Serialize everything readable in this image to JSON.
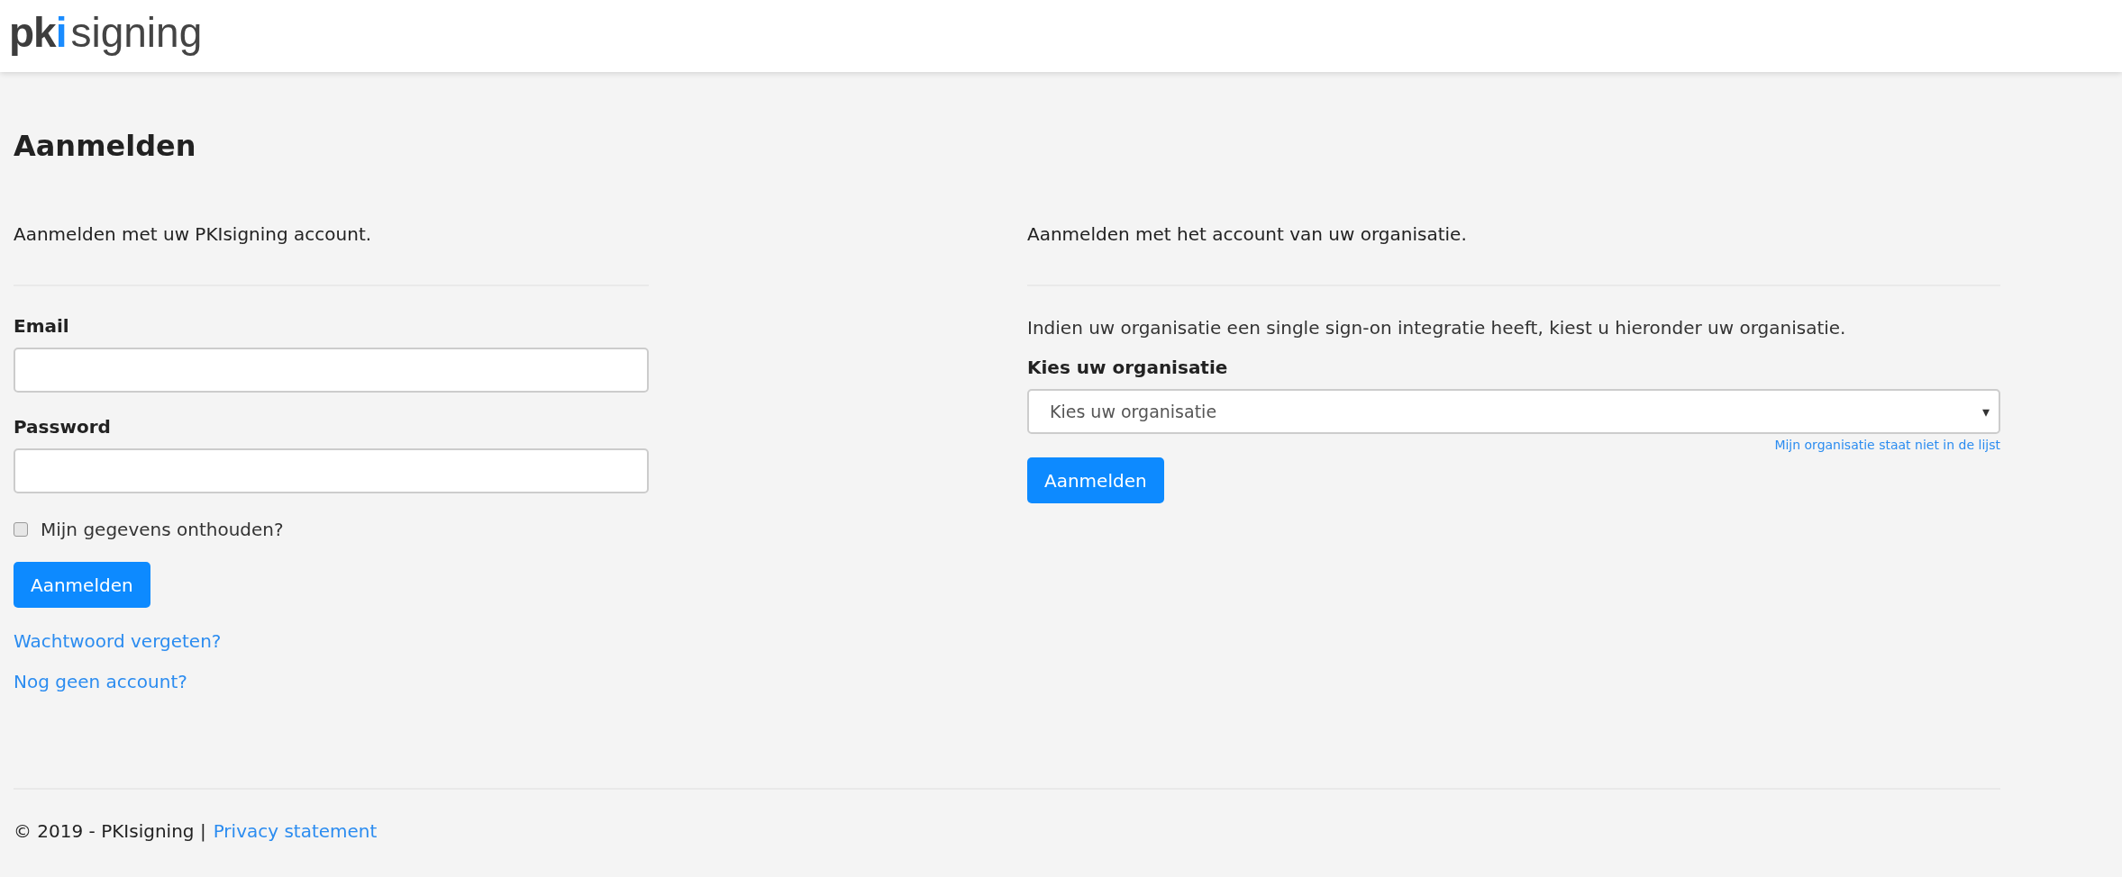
{
  "logo": {
    "part_1": "pk",
    "part_2": "i",
    "part_3": "signing"
  },
  "page_title": "Aanmelden",
  "account_login": {
    "intro": "Aanmelden met uw PKIsigning account.",
    "fields": [
      {
        "label": "Email"
      },
      {
        "label": "Password"
      }
    ],
    "remember": {
      "label": "Mijn gegevens onthouden?",
      "checked": false
    },
    "button": "Aanmelden",
    "links": [
      "Wachtwoord vergeten?",
      "Nog geen account?"
    ]
  },
  "organization_login": {
    "intro": "Aanmelden met het account van uw organisatie.",
    "description": "Indien uw organisatie een single sign-on integratie heeft, kiest u hieronder uw organisatie.",
    "label": "Kies uw organisatie",
    "select": {
      "value": "Kies uw organisatie",
      "caret": "▾"
    },
    "help_link": "Mijn organisatie staat niet in de lijst",
    "button": "Aanmelden"
  },
  "footer": {
    "text": "© 2019 - PKIsigning |",
    "link": "Privacy statement"
  }
}
